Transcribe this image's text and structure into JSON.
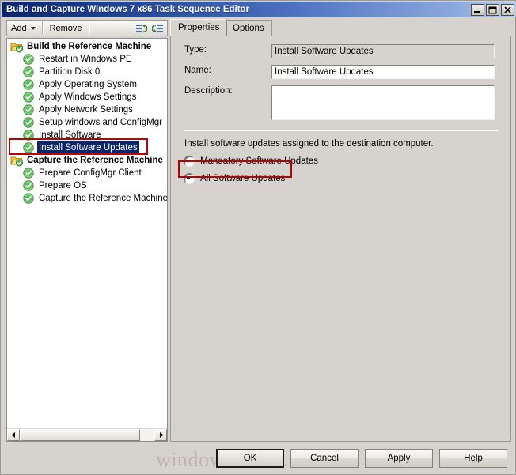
{
  "window": {
    "title": "Build and Capture Windows 7 x86 Task Sequence Editor",
    "minimize_label": "Minimize",
    "maximize_label": "Maximize",
    "close_label": "Close"
  },
  "toolbar": {
    "add_label": "Add",
    "remove_label": "Remove",
    "move_up_icon": "move-up-icon",
    "move_down_icon": "move-down-icon"
  },
  "tree": {
    "nodes": [
      {
        "label": "Build the Reference Machine",
        "type": "group",
        "icon": "task-group-icon",
        "selected": false
      },
      {
        "label": "Restart in Windows PE",
        "type": "step",
        "icon": "green-check-icon",
        "selected": false
      },
      {
        "label": "Partition Disk 0",
        "type": "step",
        "icon": "green-check-icon",
        "selected": false
      },
      {
        "label": "Apply Operating System",
        "type": "step",
        "icon": "green-check-icon",
        "selected": false
      },
      {
        "label": "Apply Windows Settings",
        "type": "step",
        "icon": "green-check-icon",
        "selected": false
      },
      {
        "label": "Apply Network Settings",
        "type": "step",
        "icon": "green-check-icon",
        "selected": false
      },
      {
        "label": "Setup windows and ConfigMgr",
        "type": "step",
        "icon": "green-check-icon",
        "selected": false
      },
      {
        "label": "Install Software",
        "type": "step",
        "icon": "green-check-icon",
        "selected": false
      },
      {
        "label": "Install Software Updates",
        "type": "step",
        "icon": "green-check-icon",
        "selected": true
      },
      {
        "label": "Capture the Reference Machine",
        "type": "group",
        "icon": "task-group-icon",
        "selected": false
      },
      {
        "label": "Prepare ConfigMgr Client",
        "type": "step",
        "icon": "green-check-icon",
        "selected": false
      },
      {
        "label": "Prepare OS",
        "type": "step",
        "icon": "green-check-icon",
        "selected": false
      },
      {
        "label": "Capture the Reference Machine",
        "type": "step",
        "icon": "green-check-icon",
        "selected": false
      }
    ],
    "scroll_left_icon": "scroll-left-arrow-icon",
    "scroll_right_icon": "scroll-right-arrow-icon"
  },
  "tabs": [
    {
      "label": "Properties",
      "active": true
    },
    {
      "label": "Options",
      "active": false
    }
  ],
  "form": {
    "type_label": "Type:",
    "type_value": "Install Software Updates",
    "name_label": "Name:",
    "name_value": "Install Software Updates",
    "name_placeholder": "",
    "description_label": "Description:",
    "description_value": "",
    "description_placeholder": ""
  },
  "options": {
    "hint": "Install software updates assigned to the destination computer.",
    "radios": [
      {
        "label": "Mandatory Software Updates",
        "selected": false
      },
      {
        "label": "All Software Updates",
        "selected": true
      }
    ]
  },
  "buttons": {
    "ok": "OK",
    "cancel": "Cancel",
    "apply": "Apply",
    "help": "Help"
  },
  "watermark": "windows-noob.com",
  "colors": {
    "title_start": "#0a246a",
    "title_end": "#b8cbe8",
    "selection": "#0a246a",
    "annotation": "#c00000",
    "panel": "#d6d3ce"
  }
}
